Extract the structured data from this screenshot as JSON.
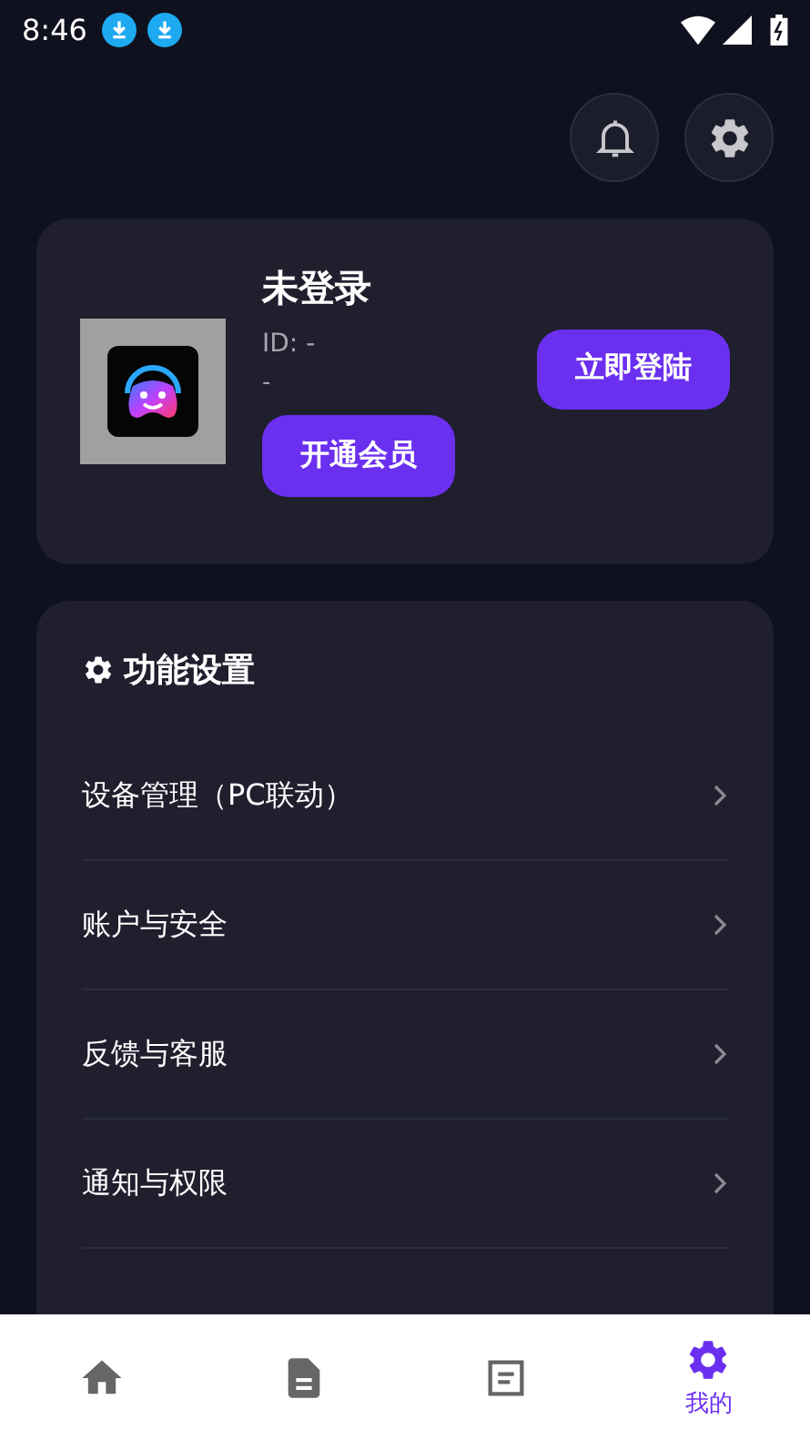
{
  "status_bar": {
    "time": "8:46",
    "notifications": [
      {
        "kind": "download"
      },
      {
        "kind": "download"
      }
    ]
  },
  "profile": {
    "name": "未登录",
    "id": "ID: -",
    "subtitle": "-",
    "vip_button": "开通会员",
    "login_button": "立即登陆"
  },
  "settings": {
    "title": "功能设置",
    "items": [
      {
        "label": "设备管理（PC联动）"
      },
      {
        "label": "账户与安全"
      },
      {
        "label": "反馈与客服"
      },
      {
        "label": "通知与权限"
      }
    ]
  },
  "nav": [
    {
      "kind": "home",
      "selected": false
    },
    {
      "kind": "document",
      "selected": false
    },
    {
      "kind": "list",
      "selected": false
    },
    {
      "kind": "profile",
      "label": "我的",
      "selected": true
    }
  ]
}
